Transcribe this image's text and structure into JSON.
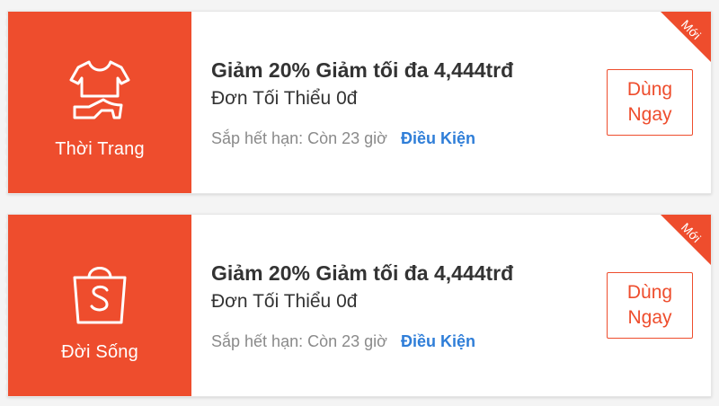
{
  "colors": {
    "brand": "#ee4d2d",
    "link": "#2f7ed8",
    "muted": "#8a8a8a"
  },
  "vouchers": [
    {
      "category_label": "Thời Trang",
      "category_icon": "fashion-clothes-shoe-icon",
      "title": "Giảm 20% Giảm tối đa 4,444trđ",
      "min_spend": "Đơn Tối Thiểu 0đ",
      "expiry": "Sắp hết hạn: Còn 23 giờ",
      "terms_link": "Điều Kiện",
      "use_button": "Dùng\nNgay",
      "badge": "Mới"
    },
    {
      "category_label": "Đời Sống",
      "category_icon": "shopping-bag-s-icon",
      "title": "Giảm 20% Giảm tối đa 4,444trđ",
      "min_spend": "Đơn Tối Thiểu 0đ",
      "expiry": "Sắp hết hạn: Còn 23 giờ",
      "terms_link": "Điều Kiện",
      "use_button": "Dùng\nNgay",
      "badge": "Mới"
    }
  ]
}
